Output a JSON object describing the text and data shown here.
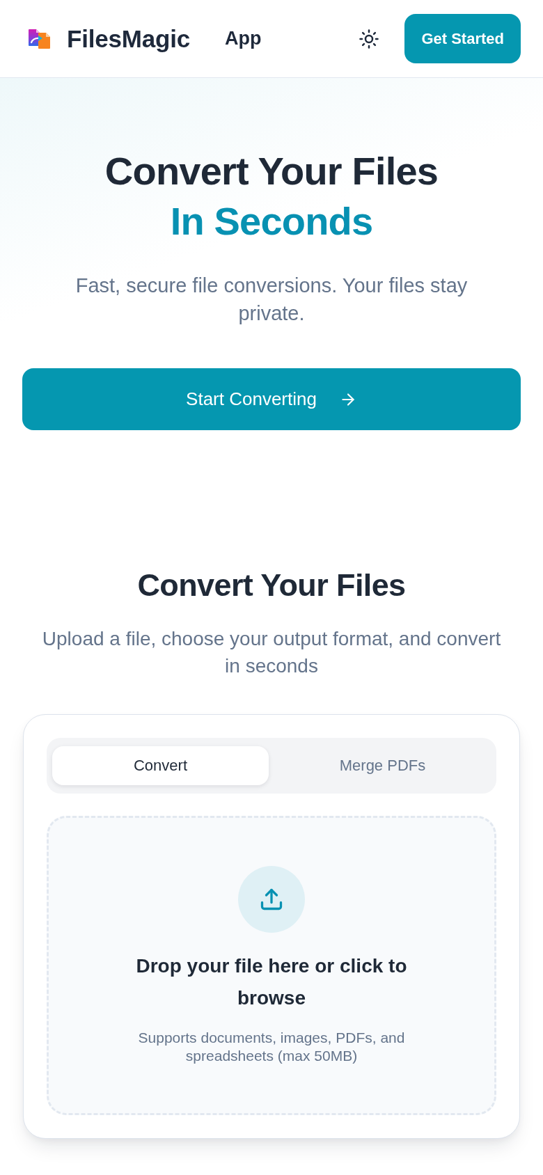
{
  "header": {
    "brand": "FilesMagic",
    "nav_link": "App",
    "cta": "Get Started"
  },
  "hero": {
    "title": "Convert Your Files",
    "title_highlight": "In Seconds",
    "subtitle": "Fast, secure file conversions. Your files stay private.",
    "button": "Start Converting"
  },
  "converter": {
    "title": "Convert Your Files",
    "subtitle": "Upload a file, choose your output format, and convert in seconds",
    "tabs": [
      {
        "label": "Convert",
        "selected": true
      },
      {
        "label": "Merge PDFs",
        "selected": false
      }
    ],
    "dropzone": {
      "title": "Drop your file here or click to browse",
      "hint": "Supports documents, images, PDFs, and spreadsheets (max 50MB)"
    }
  }
}
